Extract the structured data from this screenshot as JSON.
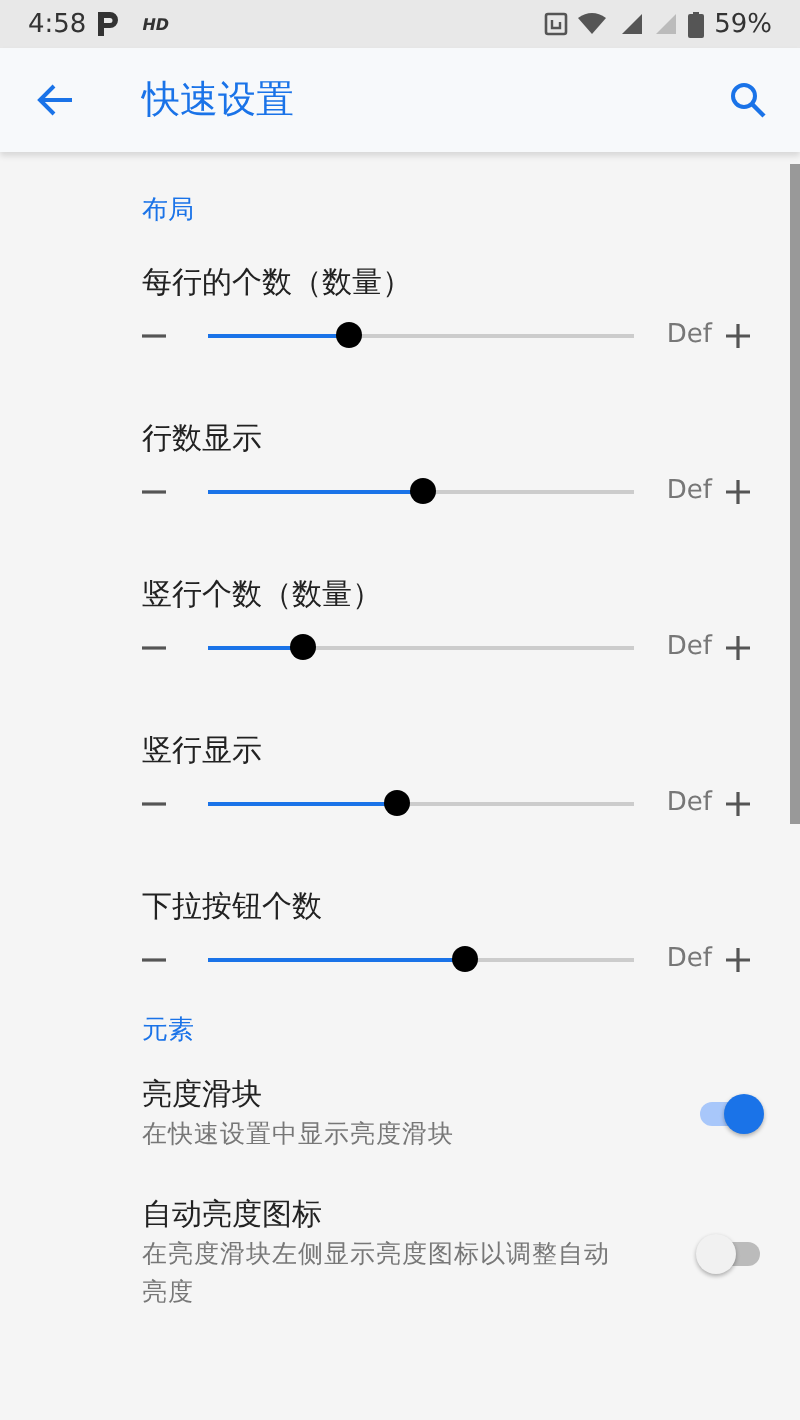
{
  "status_bar": {
    "time": "4:58",
    "hd": "HD",
    "battery": "59%"
  },
  "app_bar": {
    "title": "快速设置"
  },
  "sections": [
    {
      "header": "布局",
      "items": [
        {
          "kind": "slider",
          "title": "每行的个数（数量）",
          "level": 0.33,
          "reading": "Def"
        },
        {
          "kind": "slider",
          "title": "行数显示",
          "level": 0.5,
          "reading": "Def"
        },
        {
          "kind": "slider",
          "title": "竖行个数（数量）",
          "level": 0.22,
          "reading": "Def"
        },
        {
          "kind": "slider",
          "title": "竖行显示",
          "level": 0.44,
          "reading": "Def"
        },
        {
          "kind": "slider",
          "title": "下拉按钮个数",
          "level": 0.6,
          "reading": "Def"
        }
      ]
    },
    {
      "header": "元素",
      "items": [
        {
          "kind": "switch",
          "title": "亮度滑块",
          "summary": "在快速设置中显示亮度滑块",
          "on": true
        },
        {
          "kind": "switch",
          "title": "自动亮度图标",
          "summary": "在亮度滑块左侧显示亮度图标以调整自动亮度",
          "on": false
        }
      ]
    }
  ]
}
